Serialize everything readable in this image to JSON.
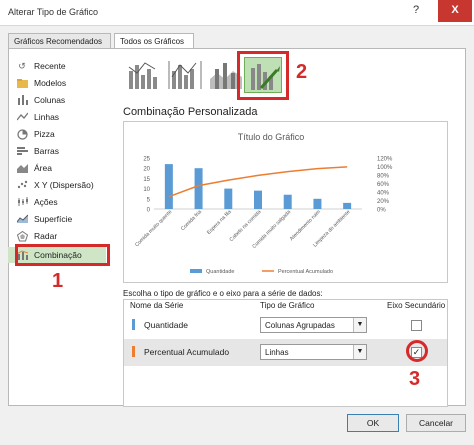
{
  "dialog": {
    "title": "Alterar Tipo de Gráfico",
    "help_label": "?",
    "close_label": "X"
  },
  "tabs": [
    {
      "label": "Gráficos Recomendados"
    },
    {
      "label": "Todos os Gráficos"
    }
  ],
  "sidebar": {
    "items": [
      {
        "label": "Recente",
        "icon": "recent-icon"
      },
      {
        "label": "Modelos",
        "icon": "folder-icon"
      },
      {
        "label": "Colunas",
        "icon": "column-chart-icon"
      },
      {
        "label": "Linhas",
        "icon": "line-chart-icon"
      },
      {
        "label": "Pizza",
        "icon": "pie-chart-icon"
      },
      {
        "label": "Barras",
        "icon": "bar-chart-icon"
      },
      {
        "label": "Área",
        "icon": "area-chart-icon"
      },
      {
        "label": "X Y (Dispersão)",
        "icon": "scatter-chart-icon"
      },
      {
        "label": "Ações",
        "icon": "stock-chart-icon"
      },
      {
        "label": "Superfície",
        "icon": "surface-chart-icon"
      },
      {
        "label": "Radar",
        "icon": "radar-chart-icon"
      },
      {
        "label": "Combinação",
        "icon": "combo-chart-icon"
      }
    ],
    "selected_index": 11
  },
  "annotations": {
    "one": "1",
    "two": "2",
    "three": "3"
  },
  "section_title": "Combinação Personalizada",
  "chart_data": {
    "type": "bar",
    "title": "Título do Gráfico",
    "categories": [
      "Comida muito quente",
      "Comida fria",
      "Espera na fila",
      "Cabelo na comida",
      "Comida muito salgada",
      "Atendimento ruim",
      "Limpeza do ambiente"
    ],
    "series": [
      {
        "name": "Quantidade",
        "type": "bar",
        "axis": "primary",
        "values": [
          22,
          20,
          10,
          9,
          7,
          5,
          3
        ]
      },
      {
        "name": "Percentual Acumulado",
        "type": "line",
        "axis": "secondary",
        "values": [
          29,
          55,
          68,
          79,
          88,
          95,
          99
        ]
      }
    ],
    "y_ticks": [
      "0",
      "5",
      "10",
      "15",
      "20",
      "25"
    ],
    "y2_ticks": [
      "0%",
      "20%",
      "40%",
      "60%",
      "80%",
      "100%",
      "120%"
    ],
    "ylim": [
      0,
      25
    ],
    "y2lim": [
      0,
      120
    ],
    "grid": false,
    "legend_position": "bottom",
    "colors": {
      "bars": "#5b9bd5",
      "line": "#ed7d31"
    }
  },
  "series_config": {
    "prompt": "Escolha o tipo de gráfico e o eixo para a série de dados:",
    "headers": {
      "name": "Nome da Série",
      "type": "Tipo de Gráfico",
      "secondary": "Eixo Secundário"
    },
    "rows": [
      {
        "name": "Quantidade",
        "chart_type": "Colunas Agrupadas",
        "secondary_axis": false,
        "color": "#5b9bd5"
      },
      {
        "name": "Percentual Acumulado",
        "chart_type": "Linhas",
        "secondary_axis": true,
        "color": "#ed7d31"
      }
    ]
  },
  "footer": {
    "ok_label": "OK",
    "cancel_label": "Cancelar"
  },
  "colors": {
    "selection": "#cfe6c6",
    "annotation": "#d52a2a"
  }
}
